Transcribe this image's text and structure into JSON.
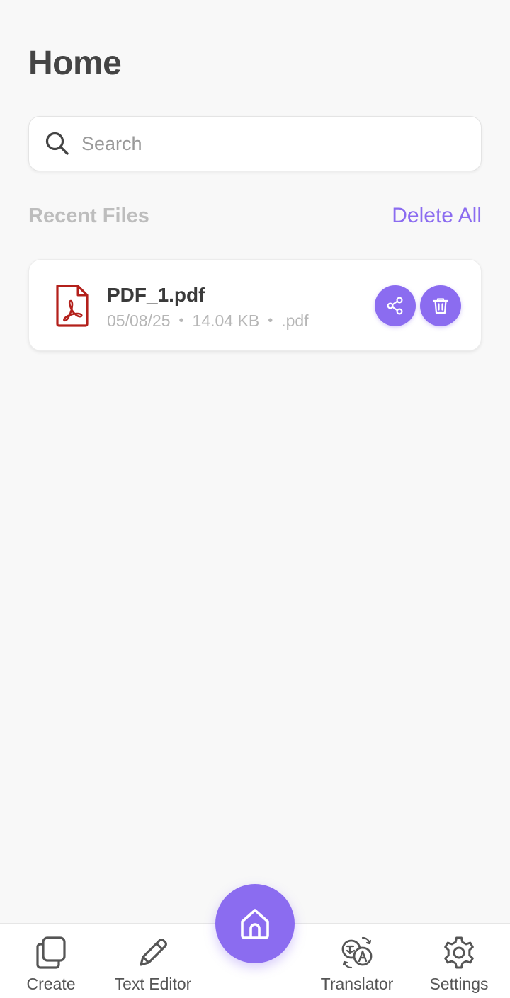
{
  "header": {
    "title": "Home"
  },
  "search": {
    "placeholder": "Search",
    "icon": "search-icon"
  },
  "recent": {
    "section_label": "Recent Files",
    "delete_all_label": "Delete All",
    "files": [
      {
        "name": "PDF_1.pdf",
        "date": "05/08/25",
        "size": "14.04 KB",
        "ext": ".pdf",
        "separator": "•",
        "icon": "pdf-file-icon"
      }
    ]
  },
  "nav": {
    "create_label": "Create",
    "text_editor_label": "Text Editor",
    "home_icon": "home-icon",
    "translator_label": "Translator",
    "settings_label": "Settings"
  },
  "colors": {
    "accent": "#8b6cf0",
    "background": "#f8f8f8",
    "pdf_red": "#b3201b",
    "title_text": "#444444",
    "muted_text": "#bdbdbd"
  }
}
